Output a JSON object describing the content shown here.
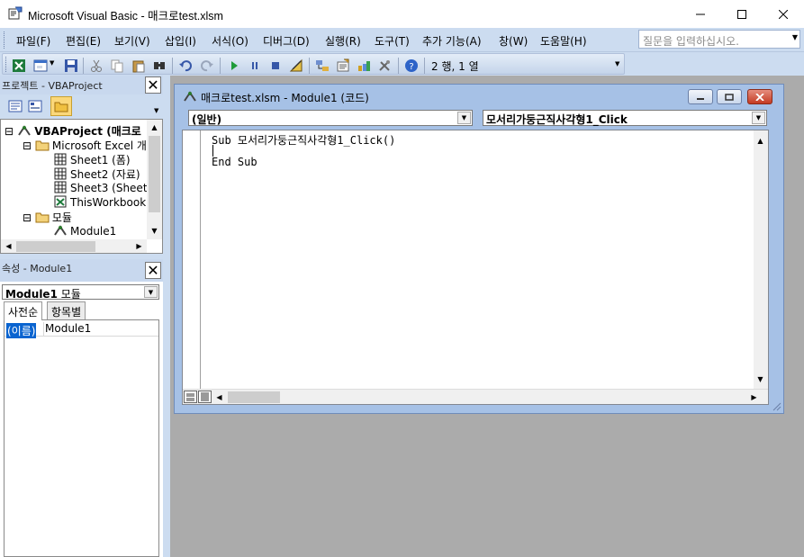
{
  "window": {
    "title": "Microsoft Visual Basic - 매크로test.xlsm",
    "icons": [
      "vba-app-icon",
      "minimize-icon",
      "maximize-icon",
      "close-icon"
    ]
  },
  "menubar": {
    "items": [
      "파일(F)",
      "편집(E)",
      "보기(V)",
      "삽입(I)",
      "서식(O)",
      "디버그(D)",
      "실행(R)",
      "도구(T)",
      "추가 기능(A)",
      "창(W)",
      "도움말(H)"
    ],
    "help_placeholder": "질문을 입력하십시오."
  },
  "toolbar": {
    "position_text": "2 행, 1 열",
    "icons": [
      "excel-view-icon",
      "insert-userform-icon",
      "save-icon",
      "cut-icon",
      "copy-icon",
      "paste-icon",
      "find-icon",
      "undo-icon",
      "redo-icon",
      "run-icon",
      "break-icon",
      "reset-icon",
      "design-mode-icon",
      "project-explorer-icon",
      "properties-icon",
      "object-browser-icon",
      "toolbox-icon",
      "help-icon"
    ]
  },
  "project_panel": {
    "title": "프로젝트 - VBAProject",
    "tree": [
      {
        "label": "VBAProject (매크로",
        "icon": "vbaproject-icon",
        "expander": "⊟"
      },
      {
        "label": "Microsoft Excel 개",
        "icon": "folder-icon",
        "expander": "⊟"
      },
      {
        "label": "Sheet1 (폼)",
        "icon": "sheet-icon",
        "expander": ""
      },
      {
        "label": "Sheet2 (자료)",
        "icon": "sheet-icon",
        "expander": ""
      },
      {
        "label": "Sheet3 (Sheet",
        "icon": "sheet-icon",
        "expander": ""
      },
      {
        "label": "ThisWorkbook",
        "icon": "workbook-icon",
        "expander": ""
      },
      {
        "label": "모듈",
        "icon": "folder-icon",
        "expander": "⊟"
      },
      {
        "label": "Module1",
        "icon": "module-icon",
        "expander": ""
      }
    ]
  },
  "properties_panel": {
    "title": "속성 - Module1",
    "selector_name": "Module1",
    "selector_type": "모듈",
    "tabs": [
      "사전순",
      "항목별"
    ],
    "rows": [
      {
        "name": "(이름)",
        "value": "Module1"
      }
    ]
  },
  "code_window": {
    "title": "매크로test.xlsm - Module1 (코드)",
    "object_combo": "(일반)",
    "procedure_combo": "모서리가둥근직사각형1_Click",
    "code_lines": [
      "Sub 모서리가둥근직사각형1_Click()",
      "",
      "End Sub"
    ]
  },
  "colors": {
    "menubar_bg": "#ccdcf0",
    "mdi_bg": "#ababab",
    "codewin_frame": "#a6c1e6",
    "selection": "#0a64d0"
  }
}
